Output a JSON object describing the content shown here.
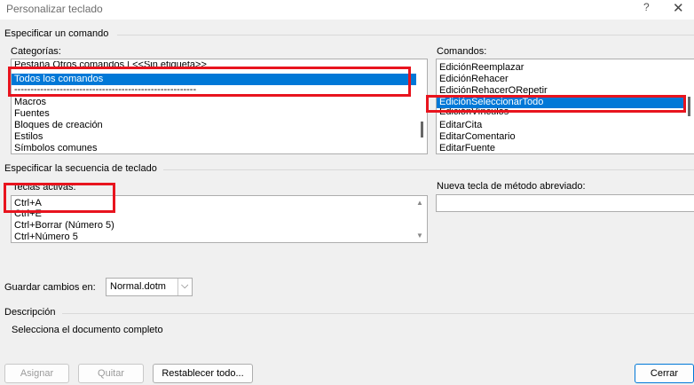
{
  "window": {
    "title": "Personalizar teclado",
    "help": "?",
    "close": "✕"
  },
  "specify_command": {
    "label": "Especificar un comando"
  },
  "categories": {
    "label": "Categorías:",
    "items": [
      "Pestaña Otros comandos | <<Sin etiqueta>>",
      "Todos los comandos",
      "--------------------------------------------------------",
      "Macros",
      "Fuentes",
      "Bloques de creación",
      "Estilos",
      "Símbolos comunes"
    ],
    "selected_index": 1
  },
  "commands": {
    "label": "Comandos:",
    "items": [
      "EdiciónReemplazar",
      "EdiciónRehacer",
      "EdiciónRehacerORepetir",
      "EdiciónSeleccionarTodo",
      "EdiciónVínculos",
      "EditarCita",
      "EditarComentario",
      "EditarFuente"
    ],
    "selected_index": 3
  },
  "key_sequence": {
    "label": "Especificar la secuencia de teclado"
  },
  "current_keys": {
    "label": "Teclas activas:",
    "items": [
      "Ctrl+A",
      "Ctrl+E",
      "Ctrl+Borrar (Número 5)",
      "Ctrl+Número 5"
    ]
  },
  "new_shortcut": {
    "label": "Nueva tecla de método abreviado:",
    "value": ""
  },
  "save_changes": {
    "label": "Guardar cambios en:",
    "value": "Normal.dotm"
  },
  "description": {
    "label": "Descripción",
    "text": "Selecciona el documento completo"
  },
  "buttons": {
    "assign": "Asignar",
    "remove": "Quitar",
    "reset_all": "Restablecer todo...",
    "close": "Cerrar"
  },
  "colors": {
    "selection": "#0078d7",
    "highlight": "#e8141e",
    "background": "#f0f0f0"
  }
}
